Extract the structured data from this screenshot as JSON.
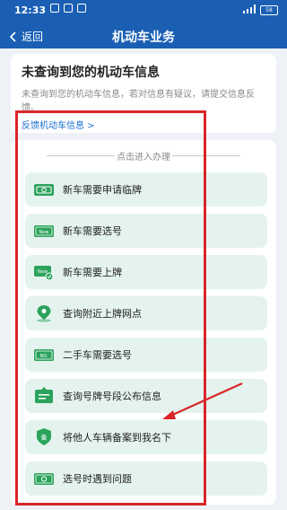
{
  "status": {
    "time": "12:33",
    "battery": "58"
  },
  "nav": {
    "back_label": "返回",
    "title": "机动车业务"
  },
  "info_card": {
    "heading": "未查询到您的机动车信息",
    "body": "未查询到您的机动车信息，若对信息有疑议，请提交信息反馈。",
    "link": "反馈机动车信息 >"
  },
  "services": {
    "section_title": "点击进入办理",
    "items": [
      {
        "label": "新车需要申请临牌",
        "icon": "temp-plate-icon"
      },
      {
        "label": "新车需要选号",
        "icon": "new-plate-icon"
      },
      {
        "label": "新车需要上牌",
        "icon": "new-plate-check-icon"
      },
      {
        "label": "查询附近上牌网点",
        "icon": "location-pin-icon"
      },
      {
        "label": "二手车需要选号",
        "icon": "plate-number-icon"
      },
      {
        "label": "查询号牌号段公布信息",
        "icon": "notice-board-icon"
      },
      {
        "label": "将他人车辆备案到我名下",
        "icon": "record-shield-icon"
      },
      {
        "label": "选号时遇到问题",
        "icon": "help-plate-icon"
      }
    ]
  },
  "colors": {
    "brand": "#1a5fb4",
    "item_bg": "#e4f3ed",
    "icon_green": "#2ba35c",
    "annotation_red": "#d9262b"
  }
}
